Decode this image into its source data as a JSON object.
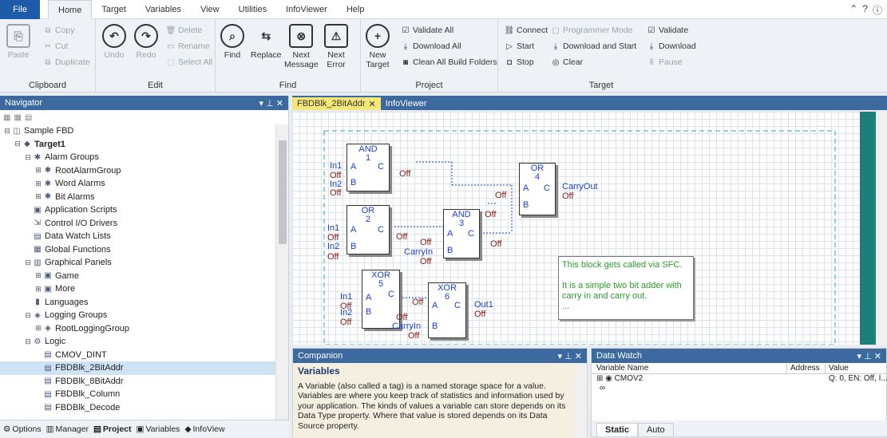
{
  "menubar": {
    "file": "File",
    "tabs": [
      "Home",
      "Target",
      "Variables",
      "View",
      "Utilities",
      "InfoViewer",
      "Help"
    ]
  },
  "ribbon": {
    "clipboard": {
      "label": "Clipboard",
      "paste": "Paste",
      "copy": "Copy",
      "cut": "Cut",
      "duplicate": "Duplicate"
    },
    "edit": {
      "label": "Edit",
      "undo": "Undo",
      "redo": "Redo",
      "delete": "Delete",
      "rename": "Rename",
      "select_all": "Select All"
    },
    "find": {
      "label": "Find",
      "find": "Find",
      "replace": "Replace",
      "next_message": "Next\nMessage",
      "next_error": "Next\nError"
    },
    "project": {
      "label": "Project",
      "new_target": "New\nTarget",
      "validate_all": "Validate All",
      "download_all": "Download All",
      "clean": "Clean All Build Folders"
    },
    "target": {
      "label": "Target",
      "connect": "Connect",
      "programmer_mode": "Programmer Mode",
      "validate": "Validate",
      "start": "Start",
      "download_and_start": "Download and Start",
      "download": "Download",
      "stop": "Stop",
      "clear": "Clear",
      "pause": "Pause"
    }
  },
  "navigator": {
    "title": "Navigator",
    "tree": [
      {
        "label": "Sample FBD",
        "level": 0,
        "exp": "⊟",
        "icon": "◫"
      },
      {
        "label": "Target1",
        "level": 1,
        "exp": "⊟",
        "icon": "◆",
        "bold": true
      },
      {
        "label": "Alarm Groups",
        "level": 2,
        "exp": "⊟",
        "icon": "✱"
      },
      {
        "label": "RootAlarmGroup",
        "level": 3,
        "exp": "⊞",
        "icon": "✱"
      },
      {
        "label": "Word Alarms",
        "level": 3,
        "exp": "⊞",
        "icon": "✱"
      },
      {
        "label": "Bit Alarms",
        "level": 3,
        "exp": "⊞",
        "icon": "✱"
      },
      {
        "label": "Application Scripts",
        "level": 2,
        "exp": "",
        "icon": "▣"
      },
      {
        "label": "Control I/O Drivers",
        "level": 2,
        "exp": "",
        "icon": "⇲"
      },
      {
        "label": "Data Watch Lists",
        "level": 2,
        "exp": "",
        "icon": "▤"
      },
      {
        "label": "Global Functions",
        "level": 2,
        "exp": "",
        "icon": "▦"
      },
      {
        "label": "Graphical Panels",
        "level": 2,
        "exp": "⊟",
        "icon": "▥"
      },
      {
        "label": "Game",
        "level": 3,
        "exp": "⊞",
        "icon": "▣"
      },
      {
        "label": "More",
        "level": 3,
        "exp": "⊞",
        "icon": "▣"
      },
      {
        "label": "Languages",
        "level": 2,
        "exp": "",
        "icon": "▮"
      },
      {
        "label": "Logging Groups",
        "level": 2,
        "exp": "⊟",
        "icon": "◈"
      },
      {
        "label": "RootLoggingGroup",
        "level": 3,
        "exp": "⊞",
        "icon": "◈"
      },
      {
        "label": "Logic",
        "level": 2,
        "exp": "⊟",
        "icon": "⚙"
      },
      {
        "label": "CMOV_DINT",
        "level": 3,
        "exp": "",
        "icon": "▤"
      },
      {
        "label": "FBDBlk_2BitAddr",
        "level": 3,
        "exp": "",
        "icon": "▤"
      },
      {
        "label": "FBDBlk_8BitAddr",
        "level": 3,
        "exp": "",
        "icon": "▤"
      },
      {
        "label": "FBDBlk_Column",
        "level": 3,
        "exp": "",
        "icon": "▤"
      },
      {
        "label": "FBDBlk_Decode",
        "level": 3,
        "exp": "",
        "icon": "▤"
      }
    ],
    "tabs": [
      "Options",
      "Manager",
      "Project",
      "Variables",
      "InfoView"
    ]
  },
  "editor": {
    "tabs": [
      "FBDBlk_2BitAddr",
      "InfoViewer"
    ],
    "blocks": [
      {
        "type": "AND",
        "num": "1"
      },
      {
        "type": "OR",
        "num": "2"
      },
      {
        "type": "AND",
        "num": "3"
      },
      {
        "type": "OR",
        "num": "4"
      },
      {
        "type": "XOR",
        "num": "5"
      },
      {
        "type": "XOR",
        "num": "6"
      }
    ],
    "labels": {
      "in1": "In1",
      "in2": "In2",
      "carryin": "CarryIn",
      "carryout": "CarryOut",
      "out1": "Out1",
      "off": "Off"
    },
    "pins": {
      "a": "A",
      "b": "B",
      "c": "C"
    },
    "note": [
      "This block gets called via SFC.",
      "It is a simple two bit adder with carry in and carry out.",
      "..."
    ]
  },
  "companion": {
    "title": "Companion",
    "heading": "Variables",
    "text": "A Variable (also called a tag) is a named storage space for a value. Variables are where you keep track of statistics and information used by your application. The kinds of values a variable can store depends on its Data Type property. Where that value is stored depends on its Data Source property."
  },
  "datawatch": {
    "title": "Data Watch",
    "columns": [
      "Variable Name",
      "Address",
      "Value"
    ],
    "rows": [
      {
        "name": "CMOV2",
        "address": "",
        "value": "Q: 0, EN: Off, I..."
      }
    ],
    "tabs": [
      "Static",
      "Auto"
    ]
  },
  "colors": {
    "accent": "#1e5ba8",
    "panel_title": "#3c6a9e",
    "tab_active": "#f5e77a",
    "fbd_blue": "#1a3fd1",
    "fbd_off": "#8b1a1a",
    "note_green": "#2a9d2a"
  }
}
